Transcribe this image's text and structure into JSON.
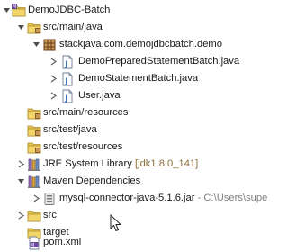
{
  "tree": {
    "project": "DemoJDBC-Batch",
    "src_main_java": "src/main/java",
    "package": "stackjava.com.demojdbcbatch.demo",
    "files": [
      "DemoPreparedStatementBatch.java",
      "DemoStatementBatch.java",
      "User.java"
    ],
    "src_main_resources": "src/main/resources",
    "src_test_java": "src/test/java",
    "src_test_resources": "src/test/resources",
    "jre": {
      "label": "JRE System Library",
      "decoration": "[jdk1.8.0_141]"
    },
    "maven": {
      "label": "Maven Dependencies"
    },
    "jar": {
      "label": "mysql-connector-java-5.1.6.jar",
      "decoration": "- C:\\Users\\supe"
    },
    "src": "src",
    "target": "target",
    "pom": "pom.xml"
  },
  "icons": {
    "project": "maven-project-icon",
    "source_folder": "source-folder-icon",
    "package": "package-icon",
    "java_file": "java-file-icon",
    "library": "library-icon",
    "jar": "jar-icon",
    "folder": "folder-icon",
    "xml": "xml-file-icon",
    "expand": "chevron-down-icon",
    "collapse": "chevron-right-icon",
    "cursor": "mouse-pointer-icon"
  },
  "colors": {
    "selection": "#dcecfa",
    "folder": "#e8c34a",
    "java": "#2f6fb2",
    "package": "#8b5a2b",
    "decoration": "#8a6d3b"
  }
}
